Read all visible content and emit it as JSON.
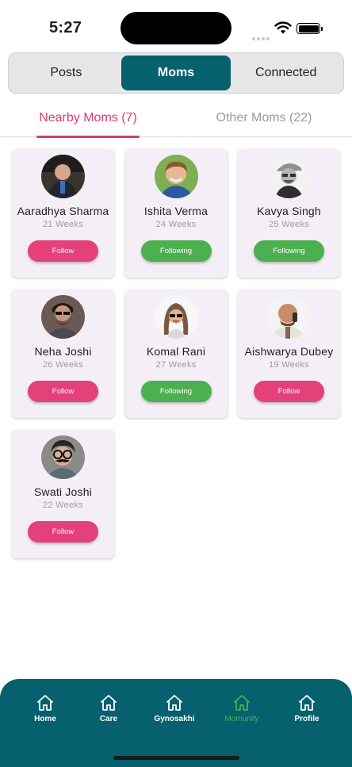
{
  "status_bar": {
    "time": "5:27"
  },
  "segments": [
    {
      "label": "Posts",
      "active": false
    },
    {
      "label": "Moms",
      "active": true
    },
    {
      "label": "Connected",
      "active": false
    }
  ],
  "subtabs": [
    {
      "label": "Nearby Moms (7)",
      "active": true
    },
    {
      "label": "Other Moms (22)",
      "active": false
    }
  ],
  "moms": [
    {
      "name": "Aaradhya Sharma",
      "weeks": "21 Weeks",
      "button": "Follow",
      "status": "follow"
    },
    {
      "name": "Ishita Verma",
      "weeks": "24 Weeks",
      "button": "Following",
      "status": "following"
    },
    {
      "name": "Kavya Singh",
      "weeks": "25 Weeks",
      "button": "Following",
      "status": "following"
    },
    {
      "name": "Neha Joshi",
      "weeks": "26 Weeks",
      "button": "Follow",
      "status": "follow"
    },
    {
      "name": "Komal Rani",
      "weeks": "27 Weeks",
      "button": "Following",
      "status": "following"
    },
    {
      "name": "Aishwarya Dubey",
      "weeks": "19 Weeks",
      "button": "Follow",
      "status": "follow"
    },
    {
      "name": "Swati Joshi",
      "weeks": "22 Weeks",
      "button": "Follow",
      "status": "follow"
    }
  ],
  "bottom_nav": [
    {
      "label": "Home",
      "icon": "home-icon",
      "active": false
    },
    {
      "label": "Care",
      "icon": "home-icon",
      "active": false
    },
    {
      "label": "Gynosakhi",
      "icon": "home-icon",
      "active": false
    },
    {
      "label": "Momunity",
      "icon": "home-icon",
      "active": true
    },
    {
      "label": "Profile",
      "icon": "home-icon",
      "active": false
    }
  ],
  "colors": {
    "primary": "#06606e",
    "accent_pink": "#e4407a",
    "following_green": "#4caf50",
    "card_bg": "#f4eff6"
  }
}
